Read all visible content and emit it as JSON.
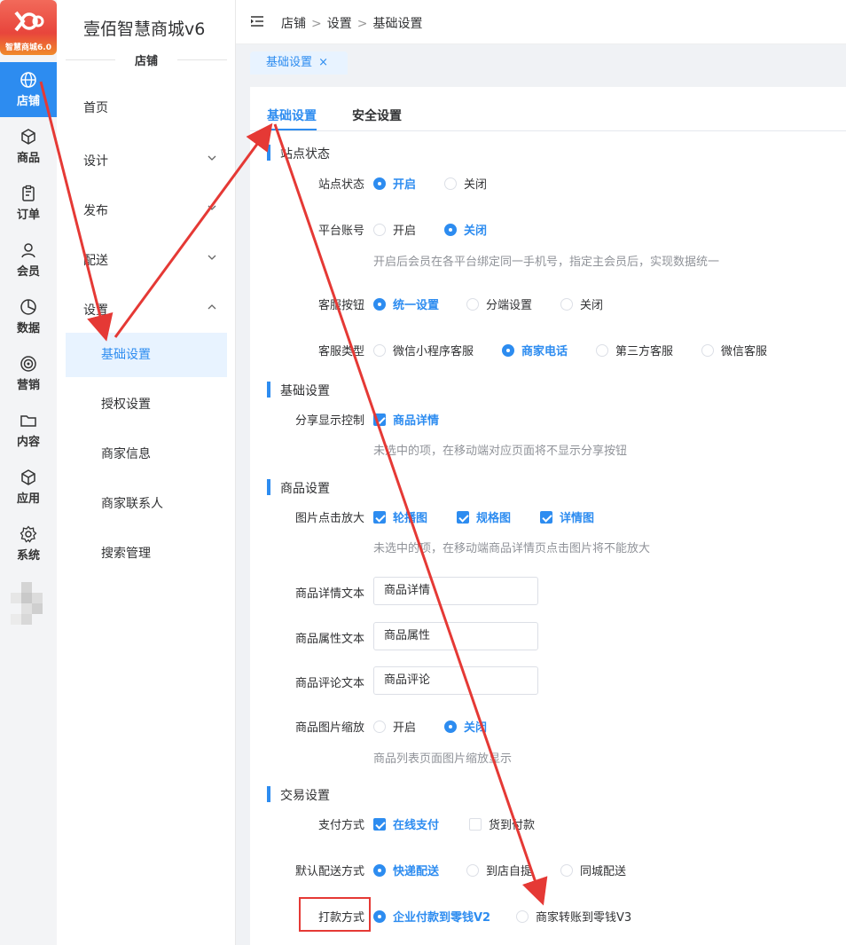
{
  "app": {
    "logo_text": "智慧商城6.0",
    "title": "壹佰智慧商城v6",
    "section": "店铺"
  },
  "rail": [
    {
      "label": "店铺",
      "icon": "globe-icon",
      "active": true
    },
    {
      "label": "商品",
      "icon": "box-icon"
    },
    {
      "label": "订单",
      "icon": "clipboard-icon"
    },
    {
      "label": "会员",
      "icon": "user-icon"
    },
    {
      "label": "数据",
      "icon": "pie-chart-icon"
    },
    {
      "label": "营销",
      "icon": "target-icon"
    },
    {
      "label": "内容",
      "icon": "folder-icon"
    },
    {
      "label": "应用",
      "icon": "cube-icon"
    },
    {
      "label": "系统",
      "icon": "gear-icon"
    }
  ],
  "sidebar": {
    "home": "首页",
    "design": "设计",
    "publish": "发布",
    "delivery": "配送",
    "settings": "设置",
    "sub_items": [
      "基础设置",
      "授权设置",
      "商家信息",
      "商家联系人",
      "搜索管理"
    ]
  },
  "breadcrumb": [
    "店铺",
    "设置",
    "基础设置"
  ],
  "page_tab": {
    "label": "基础设置",
    "close": "×"
  },
  "tabs": [
    "基础设置",
    "安全设置"
  ],
  "sections": {
    "site": "站点状态",
    "basic": "基础设置",
    "goods": "商品设置",
    "trade": "交易设置"
  },
  "form": {
    "site_status": {
      "label": "站点状态",
      "options": [
        "开启",
        "关闭"
      ],
      "selected": "开启"
    },
    "platform_account": {
      "label": "平台账号",
      "options": [
        "开启",
        "关闭"
      ],
      "selected": "关闭",
      "hint": "开启后会员在各平台绑定同一手机号，指定主会员后，实现数据统一"
    },
    "cs_button": {
      "label": "客服按钮",
      "options": [
        "统一设置",
        "分端设置",
        "关闭"
      ],
      "selected": "统一设置"
    },
    "cs_type": {
      "label": "客服类型",
      "options": [
        "微信小程序客服",
        "商家电话",
        "第三方客服",
        "微信客服"
      ],
      "selected": "商家电话"
    },
    "share_control": {
      "label": "分享显示控制",
      "options": [
        "商品详情"
      ],
      "checked": [
        "商品详情"
      ],
      "hint": "未选中的项，在移动端对应页面将不显示分享按钮"
    },
    "image_zoom": {
      "label": "图片点击放大",
      "options": [
        "轮播图",
        "规格图",
        "详情图"
      ],
      "checked": [
        "轮播图",
        "规格图",
        "详情图"
      ],
      "hint": "未选中的项，在移动端商品详情页点击图片将不能放大"
    },
    "detail_text": {
      "label": "商品详情文本",
      "value": "商品详情"
    },
    "attr_text": {
      "label": "商品属性文本",
      "value": "商品属性"
    },
    "comment_text": {
      "label": "商品评论文本",
      "value": "商品评论"
    },
    "image_scale": {
      "label": "商品图片缩放",
      "options": [
        "开启",
        "关闭"
      ],
      "selected": "关闭",
      "hint": "商品列表页面图片缩放显示"
    },
    "pay_method": {
      "label": "支付方式",
      "options": [
        "在线支付",
        "货到付款"
      ],
      "checked": [
        "在线支付"
      ]
    },
    "default_delivery": {
      "label": "默认配送方式",
      "options": [
        "快递配送",
        "到店自提",
        "同城配送"
      ],
      "selected": "快递配送"
    },
    "payout_method": {
      "label": "打款方式",
      "options": [
        "企业付款到零钱V2",
        "商家转账到零钱V3"
      ],
      "selected": "企业付款到零钱V2"
    }
  },
  "colors": {
    "accent": "#2d8cf0",
    "annotation": "#e53935"
  }
}
